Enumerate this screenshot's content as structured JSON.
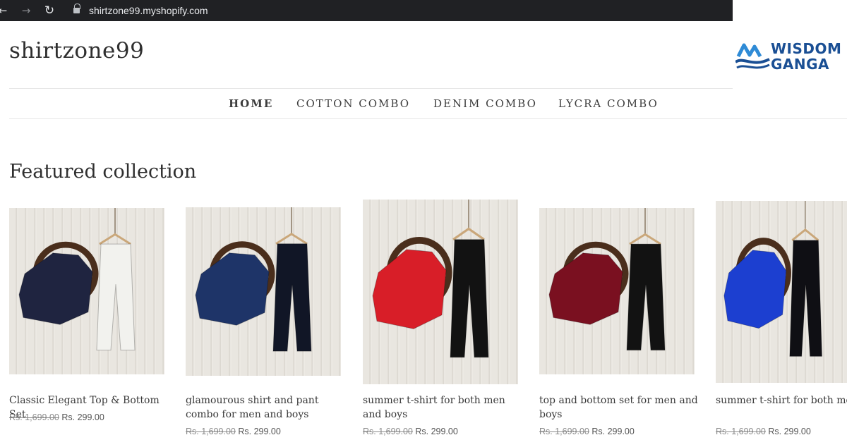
{
  "browser": {
    "url": "shirtzone99.myshopify.com",
    "back_icon": "arrow-left-icon",
    "forward_icon": "arrow-right-icon",
    "reload_icon": "reload-icon",
    "lock_icon": "lock-icon"
  },
  "watermark": {
    "line1": "WISDOM",
    "line2": "GANGA",
    "color": "#1a4f94"
  },
  "site": {
    "title": "shirtzone99"
  },
  "nav": {
    "home": "HOME",
    "cotton": "COTTON COMBO",
    "denim": "DENIM COMBO",
    "lycra": "LYCRA COMBO"
  },
  "featured": {
    "title": "Featured collection",
    "products": [
      {
        "title": "Classic Elegant Top & Bottom Set",
        "price_old": "Rs. 1,699.00",
        "price_new": "Rs. 299.00",
        "top_color": "#1f2440",
        "bottom_color": "#f2f2ee"
      },
      {
        "title": "glamourous shirt and pant combo for men and boys",
        "price_old": "Rs. 1,699.00",
        "price_new": "Rs. 299.00",
        "top_color": "#1e3468",
        "bottom_color": "#111626"
      },
      {
        "title": "summer t-shirt for both men and boys",
        "price_old": "Rs. 1,699.00",
        "price_new": "Rs. 299.00",
        "top_color": "#d81e28",
        "bottom_color": "#121212"
      },
      {
        "title": "top and bottom set for men and boys",
        "price_old": "Rs. 1,699.00",
        "price_new": "Rs. 299.00",
        "top_color": "#7a1020",
        "bottom_color": "#121212"
      },
      {
        "title": "summer t-shirt for both men and boys",
        "price_old": "Rs. 1,699.00",
        "price_new": "Rs. 299.00",
        "top_color": "#1c3fd0",
        "bottom_color": "#0f0f14"
      }
    ]
  }
}
